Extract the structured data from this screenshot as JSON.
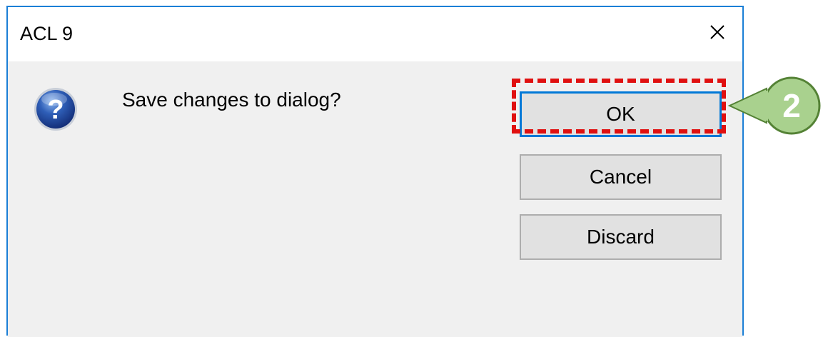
{
  "window": {
    "title": "ACL 9",
    "accent": "#1b7fd6"
  },
  "dialog": {
    "message": "Save changes to dialog?",
    "icon": "question-icon"
  },
  "buttons": {
    "ok_label": "OK",
    "cancel_label": "Cancel",
    "discard_label": "Discard"
  },
  "annotation": {
    "step_number": "2",
    "highlight_color": "#e01010",
    "callout_color": "#a9d18e"
  }
}
